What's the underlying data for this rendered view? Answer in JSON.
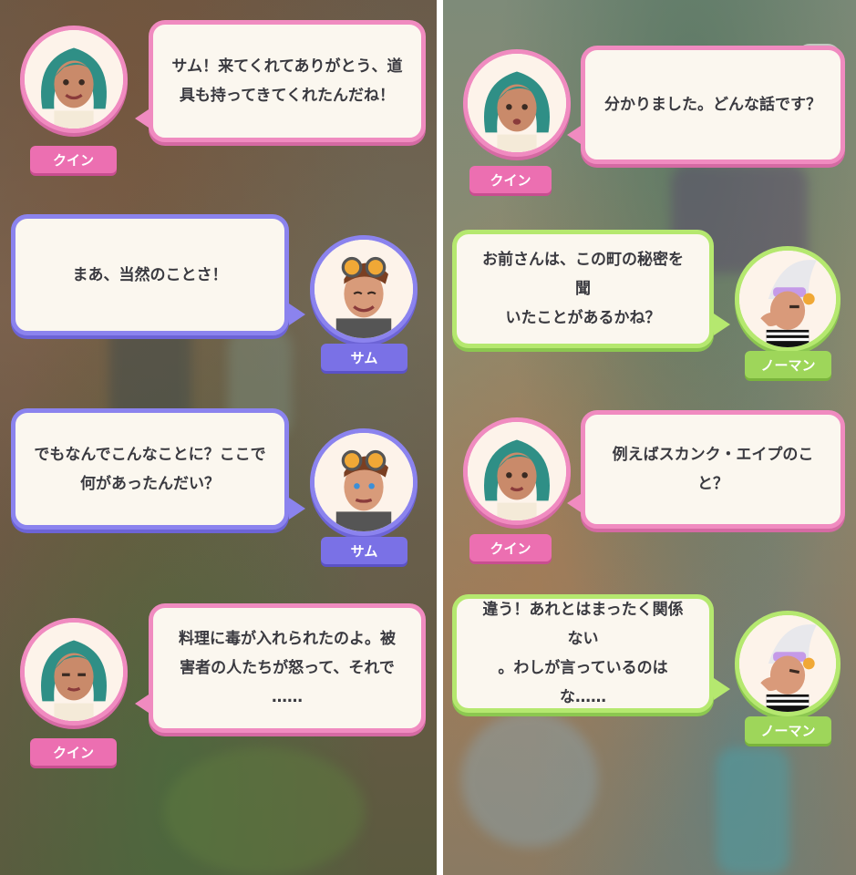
{
  "left_panel": {
    "skip_icon": "fast-forward-icon",
    "dialogues": [
      {
        "speaker": "クイン",
        "text": "サム！来てくれてありがとう、道\n具も持ってきてくれたんだね！",
        "color": "pink"
      },
      {
        "speaker": "サム",
        "text": "まあ、当然のことさ！",
        "color": "purple"
      },
      {
        "speaker": "サム",
        "text": "でもなんでこんなことに？ここで\n何があったんだい？",
        "color": "purple"
      },
      {
        "speaker": "クイン",
        "text": "料理に毒が入れられたのよ。被\n害者の人たちが怒って、それで\n……",
        "color": "pink"
      }
    ]
  },
  "right_panel": {
    "skip_icon": "fast-forward-icon",
    "dialogues": [
      {
        "speaker": "クイン",
        "text": "分かりました。どんな話です？",
        "color": "pink"
      },
      {
        "speaker": "ノーマン",
        "text": "お前さんは、この町の秘密を聞\nいたことがあるかね？",
        "color": "green"
      },
      {
        "speaker": "クイン",
        "text": "例えばスカンク・エイプのこと？",
        "color": "pink"
      },
      {
        "speaker": "ノーマン",
        "text": "違う！あれとはまったく関係ない\n。わしが言っているのはな……",
        "color": "green"
      }
    ]
  },
  "colors": {
    "pink": "#f08bc0",
    "purple": "#8b83ee",
    "green": "#b5e86f"
  }
}
